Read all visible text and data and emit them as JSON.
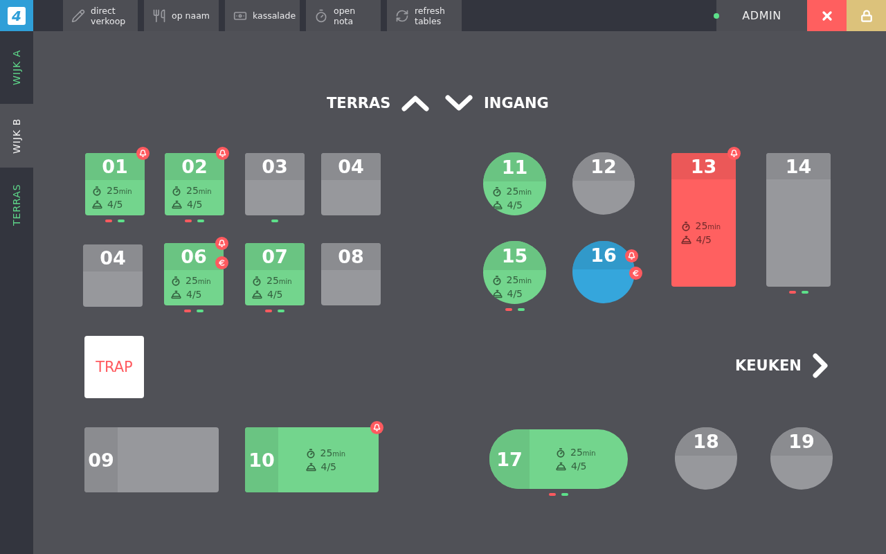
{
  "topbar": {
    "logo": "4",
    "actions": [
      {
        "label": "direct\nverkoop"
      },
      {
        "label": "op naam"
      },
      {
        "label": "kassalade"
      },
      {
        "label": "open nota"
      },
      {
        "label": "refresh\ntables"
      }
    ],
    "online": true,
    "user": "ADMIN"
  },
  "sections": [
    {
      "label": "WIJK A",
      "selected": false
    },
    {
      "label": "WIJK B",
      "selected": true
    },
    {
      "label": "TERRAS",
      "selected": false
    }
  ],
  "nav": {
    "up": "TERRAS",
    "down": "INGANG",
    "right": "KEUKEN"
  },
  "landmarks": [
    {
      "label": "TRAP"
    }
  ],
  "tables": [
    {
      "number": "01",
      "kind": "square",
      "color": "#73d58d",
      "time": "25",
      "unit": "min",
      "guests": "4/5",
      "alerts": [
        {
          "kind": "bell"
        }
      ],
      "markers": [
        {
          "color": "#ff5a5f"
        },
        {
          "color": "#5de08a"
        }
      ]
    },
    {
      "number": "02",
      "kind": "square",
      "color": "#73d58d",
      "time": "25",
      "unit": "min",
      "guests": "4/5",
      "alerts": [
        {
          "kind": "bell"
        }
      ],
      "markers": [
        {
          "color": "#ff5a5f"
        },
        {
          "color": "#5de08a"
        }
      ]
    },
    {
      "number": "03",
      "kind": "square",
      "color": "#97989c",
      "markers": [
        {
          "color": "#5de08a"
        }
      ]
    },
    {
      "number": "04",
      "kind": "square",
      "color": "#97989c"
    },
    {
      "number": "04",
      "kind": "square",
      "color": "#97989c"
    },
    {
      "number": "06",
      "kind": "square",
      "color": "#73d58d",
      "time": "25",
      "unit": "min",
      "guests": "4/5",
      "alerts": [
        {
          "kind": "bell"
        },
        {
          "kind": "euro"
        }
      ],
      "markers": [
        {
          "color": "#ff5a5f"
        },
        {
          "color": "#5de08a"
        }
      ]
    },
    {
      "number": "07",
      "kind": "square",
      "color": "#73d58d",
      "time": "25",
      "unit": "min",
      "guests": "4/5",
      "markers": [
        {
          "color": "#ff5a5f"
        },
        {
          "color": "#5de08a"
        }
      ]
    },
    {
      "number": "08",
      "kind": "square",
      "color": "#97989c"
    },
    {
      "number": "11",
      "kind": "round",
      "color": "#73d58d",
      "time": "25",
      "unit": "min",
      "guests": "4/5"
    },
    {
      "number": "12",
      "kind": "round",
      "color": "#97989c"
    },
    {
      "number": "13",
      "kind": "tall",
      "color": "#ff6060",
      "time": "25",
      "unit": "min",
      "guests": "4/5",
      "alerts": [
        {
          "kind": "bell"
        }
      ]
    },
    {
      "number": "14",
      "kind": "tall",
      "color": "#97989c",
      "markers": [
        {
          "color": "#ff5a5f"
        },
        {
          "color": "#5de08a"
        }
      ]
    },
    {
      "number": "15",
      "kind": "round",
      "color": "#73d58d",
      "time": "25",
      "unit": "min",
      "guests": "4/5",
      "markers": [
        {
          "color": "#ff5a5f"
        },
        {
          "color": "#5de08a"
        }
      ]
    },
    {
      "number": "16",
      "kind": "round",
      "color": "#35a6dc",
      "alerts": [
        {
          "kind": "bell"
        },
        {
          "kind": "euro"
        }
      ]
    },
    {
      "number": "09",
      "kind": "wide",
      "color": "#97989c"
    },
    {
      "number": "10",
      "kind": "wide",
      "color": "#73d58d",
      "time": "25",
      "unit": "min",
      "guests": "4/5",
      "alerts": [
        {
          "kind": "bell"
        }
      ]
    },
    {
      "number": "17",
      "kind": "pill",
      "color": "#73d58d",
      "time": "25",
      "unit": "min",
      "guests": "4/5",
      "markers": [
        {
          "color": "#ff5a5f"
        },
        {
          "color": "#5de08a"
        }
      ]
    },
    {
      "number": "18",
      "kind": "round",
      "color": "#97989c"
    },
    {
      "number": "19",
      "kind": "round",
      "color": "#97989c"
    }
  ]
}
